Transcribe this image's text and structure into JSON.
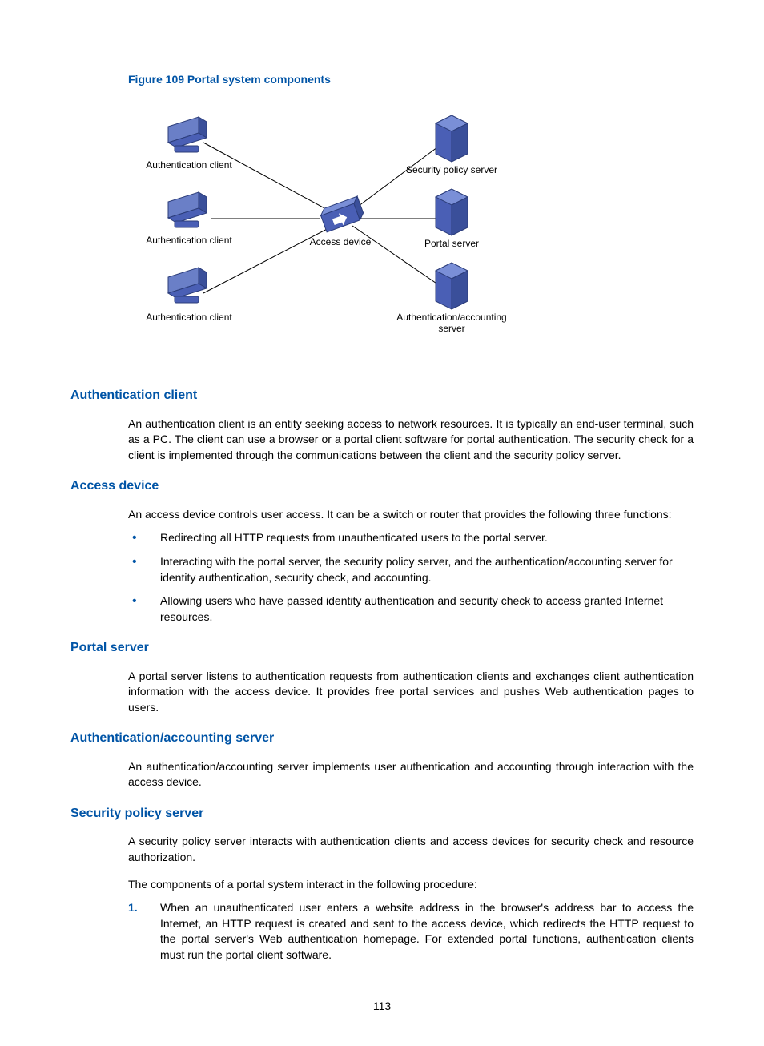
{
  "figure": {
    "caption": "Figure 109 Portal system components",
    "labels": {
      "client1": "Authentication client",
      "client2": "Authentication client",
      "client3": "Authentication client",
      "access": "Access device",
      "policy": "Security policy server",
      "portal": "Portal server",
      "auth": "Authentication/accounting",
      "auth2": "server"
    }
  },
  "sections": {
    "authClient": {
      "title": "Authentication client",
      "para": "An authentication client is an entity seeking access to network resources. It is typically an end-user terminal, such as a PC. The client can use a browser or a portal client software for portal authentication. The security check for a client is implemented through the communications between the client and the security policy server."
    },
    "accessDevice": {
      "title": "Access device",
      "intro": "An access device controls user access. It can be a switch or router that provides the following three functions:",
      "b1": "Redirecting all HTTP requests from unauthenticated users to the portal server.",
      "b2": "Interacting with the portal server, the security policy server, and the authentication/accounting server for identity authentication, security check, and accounting.",
      "b3": "Allowing users who have passed identity authentication and security check to access granted Internet resources."
    },
    "portalServer": {
      "title": "Portal server",
      "para": "A portal server listens to authentication requests from authentication clients and exchanges client authentication information with the access device. It provides free portal services and pushes Web authentication pages to users."
    },
    "authAcct": {
      "title": "Authentication/accounting server",
      "para": "An authentication/accounting server implements user authentication and accounting through interaction with the access device."
    },
    "securityPolicy": {
      "title": "Security policy server",
      "para1": "A security policy server interacts with authentication clients and access devices for security check and resource authorization.",
      "para2": "The components of a portal system interact in the following procedure:",
      "step1num": "1.",
      "step1": "When an unauthenticated user enters a website address in the browser's address bar to access the Internet, an HTTP request is created and sent to the access device, which redirects the HTTP request to the portal server's Web authentication homepage. For extended portal functions, authentication clients must run the portal client software."
    }
  },
  "pageNumber": "113"
}
